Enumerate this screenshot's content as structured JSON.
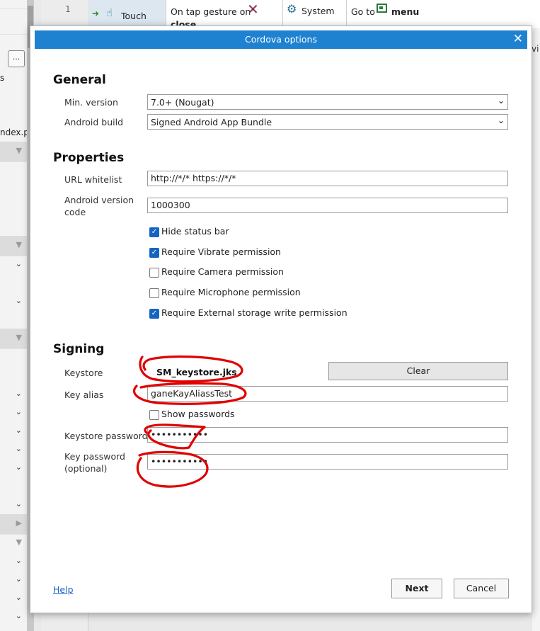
{
  "background": {
    "row_number": "1",
    "left_fragments": [
      "s",
      "ndex.p"
    ],
    "dots_label": "...",
    "table": {
      "touch_label": "Touch",
      "on_tap_line1": "On tap gesture on",
      "on_tap_line2": "close",
      "system_label": "System",
      "goto_prefix": "Go to",
      "goto_target": "menu"
    },
    "right_fragment": "vi"
  },
  "dialog": {
    "title": "Cordova options",
    "close_glyph": "✕",
    "general": {
      "heading": "General",
      "min_version_label": "Min. version",
      "min_version_value": "7.0+ (Nougat)",
      "android_build_label": "Android build",
      "android_build_value": "Signed Android App Bundle"
    },
    "properties": {
      "heading": "Properties",
      "url_whitelist_label": "URL whitelist",
      "url_whitelist_value": "http://*/* https://*/*",
      "version_code_label_1": "Android version",
      "version_code_label_2": "code",
      "version_code_value": "1000300",
      "checkboxes": [
        {
          "label": "Hide status bar",
          "checked": true
        },
        {
          "label": "Require Vibrate permission",
          "checked": true
        },
        {
          "label": "Require Camera permission",
          "checked": false
        },
        {
          "label": "Require Microphone permission",
          "checked": false
        },
        {
          "label": "Require External storage write permission",
          "checked": true
        }
      ]
    },
    "signing": {
      "heading": "Signing",
      "keystore_label": "Keystore",
      "keystore_value": "SM_keystore.jks",
      "clear_label": "Clear",
      "key_alias_label": "Key alias",
      "key_alias_value": "ganeKayAliassTest",
      "show_passwords_label": "Show passwords",
      "show_passwords_checked": false,
      "keystore_password_label": "Keystore password",
      "keystore_password_value": "•••••••••••",
      "key_password_label_1": "Key password",
      "key_password_label_2": "(optional)",
      "key_password_value": "•••••••••••"
    },
    "footer": {
      "help_label": "Help",
      "next_label": "Next",
      "cancel_label": "Cancel"
    }
  },
  "colors": {
    "titlebar": "#1f82d0",
    "annotation": "#e00000",
    "checkbox_checked": "#1565c0"
  }
}
